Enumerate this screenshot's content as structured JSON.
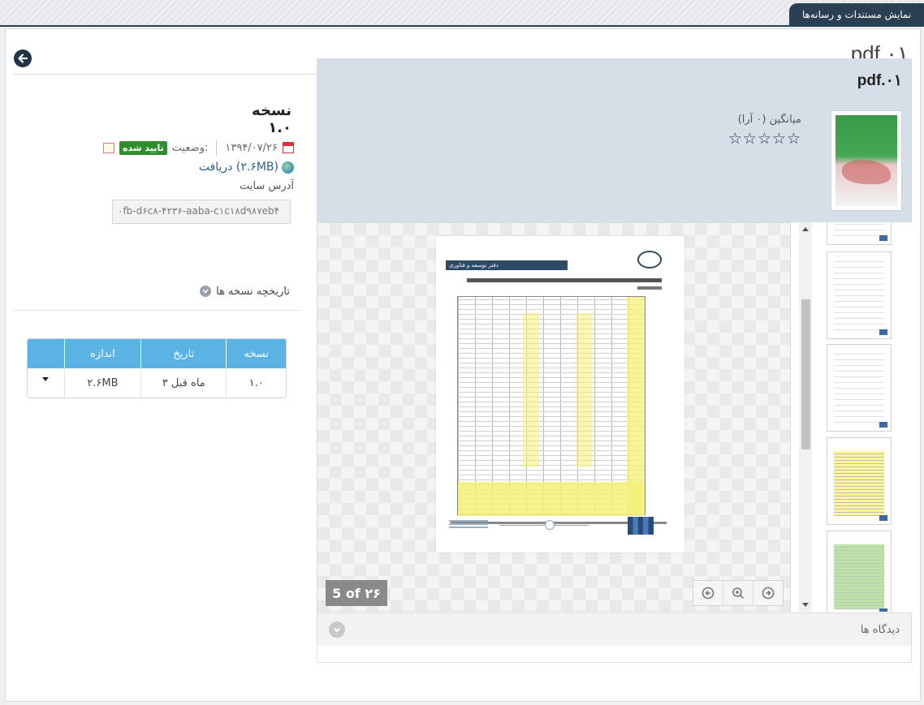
{
  "header": {
    "tab_label": "نمایش مستندات و رسانه‌ها"
  },
  "page": {
    "title": "pdf.۰۱"
  },
  "version_info": {
    "title": "نسخه ۱.۰",
    "date": "۱۳۹۴/۰۷/۲۶",
    "status_label": "وضعیت:",
    "status_badge": "تایید شده",
    "download_label": "دریافت (۲.۶MB)",
    "site_address_label": "آدرس سایت",
    "site_address_value": "۰fb-d۶c۸-۴۲۳۶-aaba-c۱c۱۸d۹۸۷eb۴"
  },
  "history": {
    "label": "تاریخچه نسخه ها",
    "columns": {
      "version": "نسخه",
      "date": "تاریخ",
      "size": "اندازه"
    },
    "rows": [
      {
        "version": "۱.۰",
        "date": "۳ ماه قبل",
        "size": "۲.۶MB"
      }
    ]
  },
  "document": {
    "title": "pdf.۰۱",
    "average_label": "میانگین (۰ آرا)",
    "rating": {
      "value": 0,
      "max": 5
    },
    "star_glyphs": "☆☆☆☆☆",
    "pager": "5 of ۲۶",
    "page_header_text": "دفتر توسعه و فناوری"
  },
  "comments": {
    "label": "دیدگاه ها"
  },
  "icons": {
    "back": "arrow-left-icon",
    "calendar": "calendar-icon",
    "note": "note-icon",
    "globe": "globe-icon",
    "chevron": "chevron-down-icon",
    "caret": "caret-down-icon",
    "prev": "arrow-left-icon",
    "zoom": "zoom-in-icon",
    "next": "arrow-right-icon",
    "star": "star-outline-icon"
  },
  "colors": {
    "brand_dark": "#2b3f52",
    "table_header": "#5ab3e3",
    "badge_green": "#2f8f2f",
    "panel_bg": "#d6dfe7"
  }
}
